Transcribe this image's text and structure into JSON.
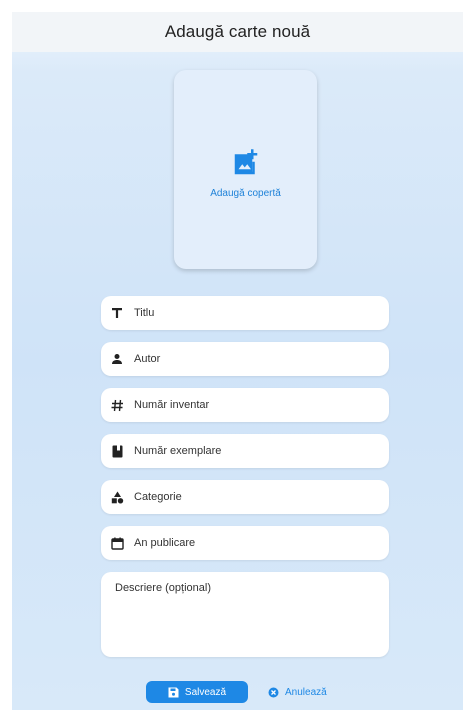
{
  "header": {
    "title": "Adaugă carte nouă"
  },
  "cover": {
    "label": "Adaugă copertă",
    "icon": "add-photo-icon"
  },
  "fields": [
    {
      "label": "Titlu",
      "icon": "title-icon"
    },
    {
      "label": "Autor",
      "icon": "person-icon"
    },
    {
      "label": "Număr inventar",
      "icon": "hash-icon"
    },
    {
      "label": "Număr exemplare",
      "icon": "book-icon"
    },
    {
      "label": "Categorie",
      "icon": "category-icon"
    },
    {
      "label": "An publicare",
      "icon": "calendar-icon"
    }
  ],
  "description": {
    "label": "Descriere (opțional)"
  },
  "actions": {
    "save_label": "Salvează",
    "cancel_label": "Anulează"
  },
  "colors": {
    "accent": "#1e88e5",
    "cover_bg": "#e3eefb",
    "field_bg": "#ffffff"
  }
}
